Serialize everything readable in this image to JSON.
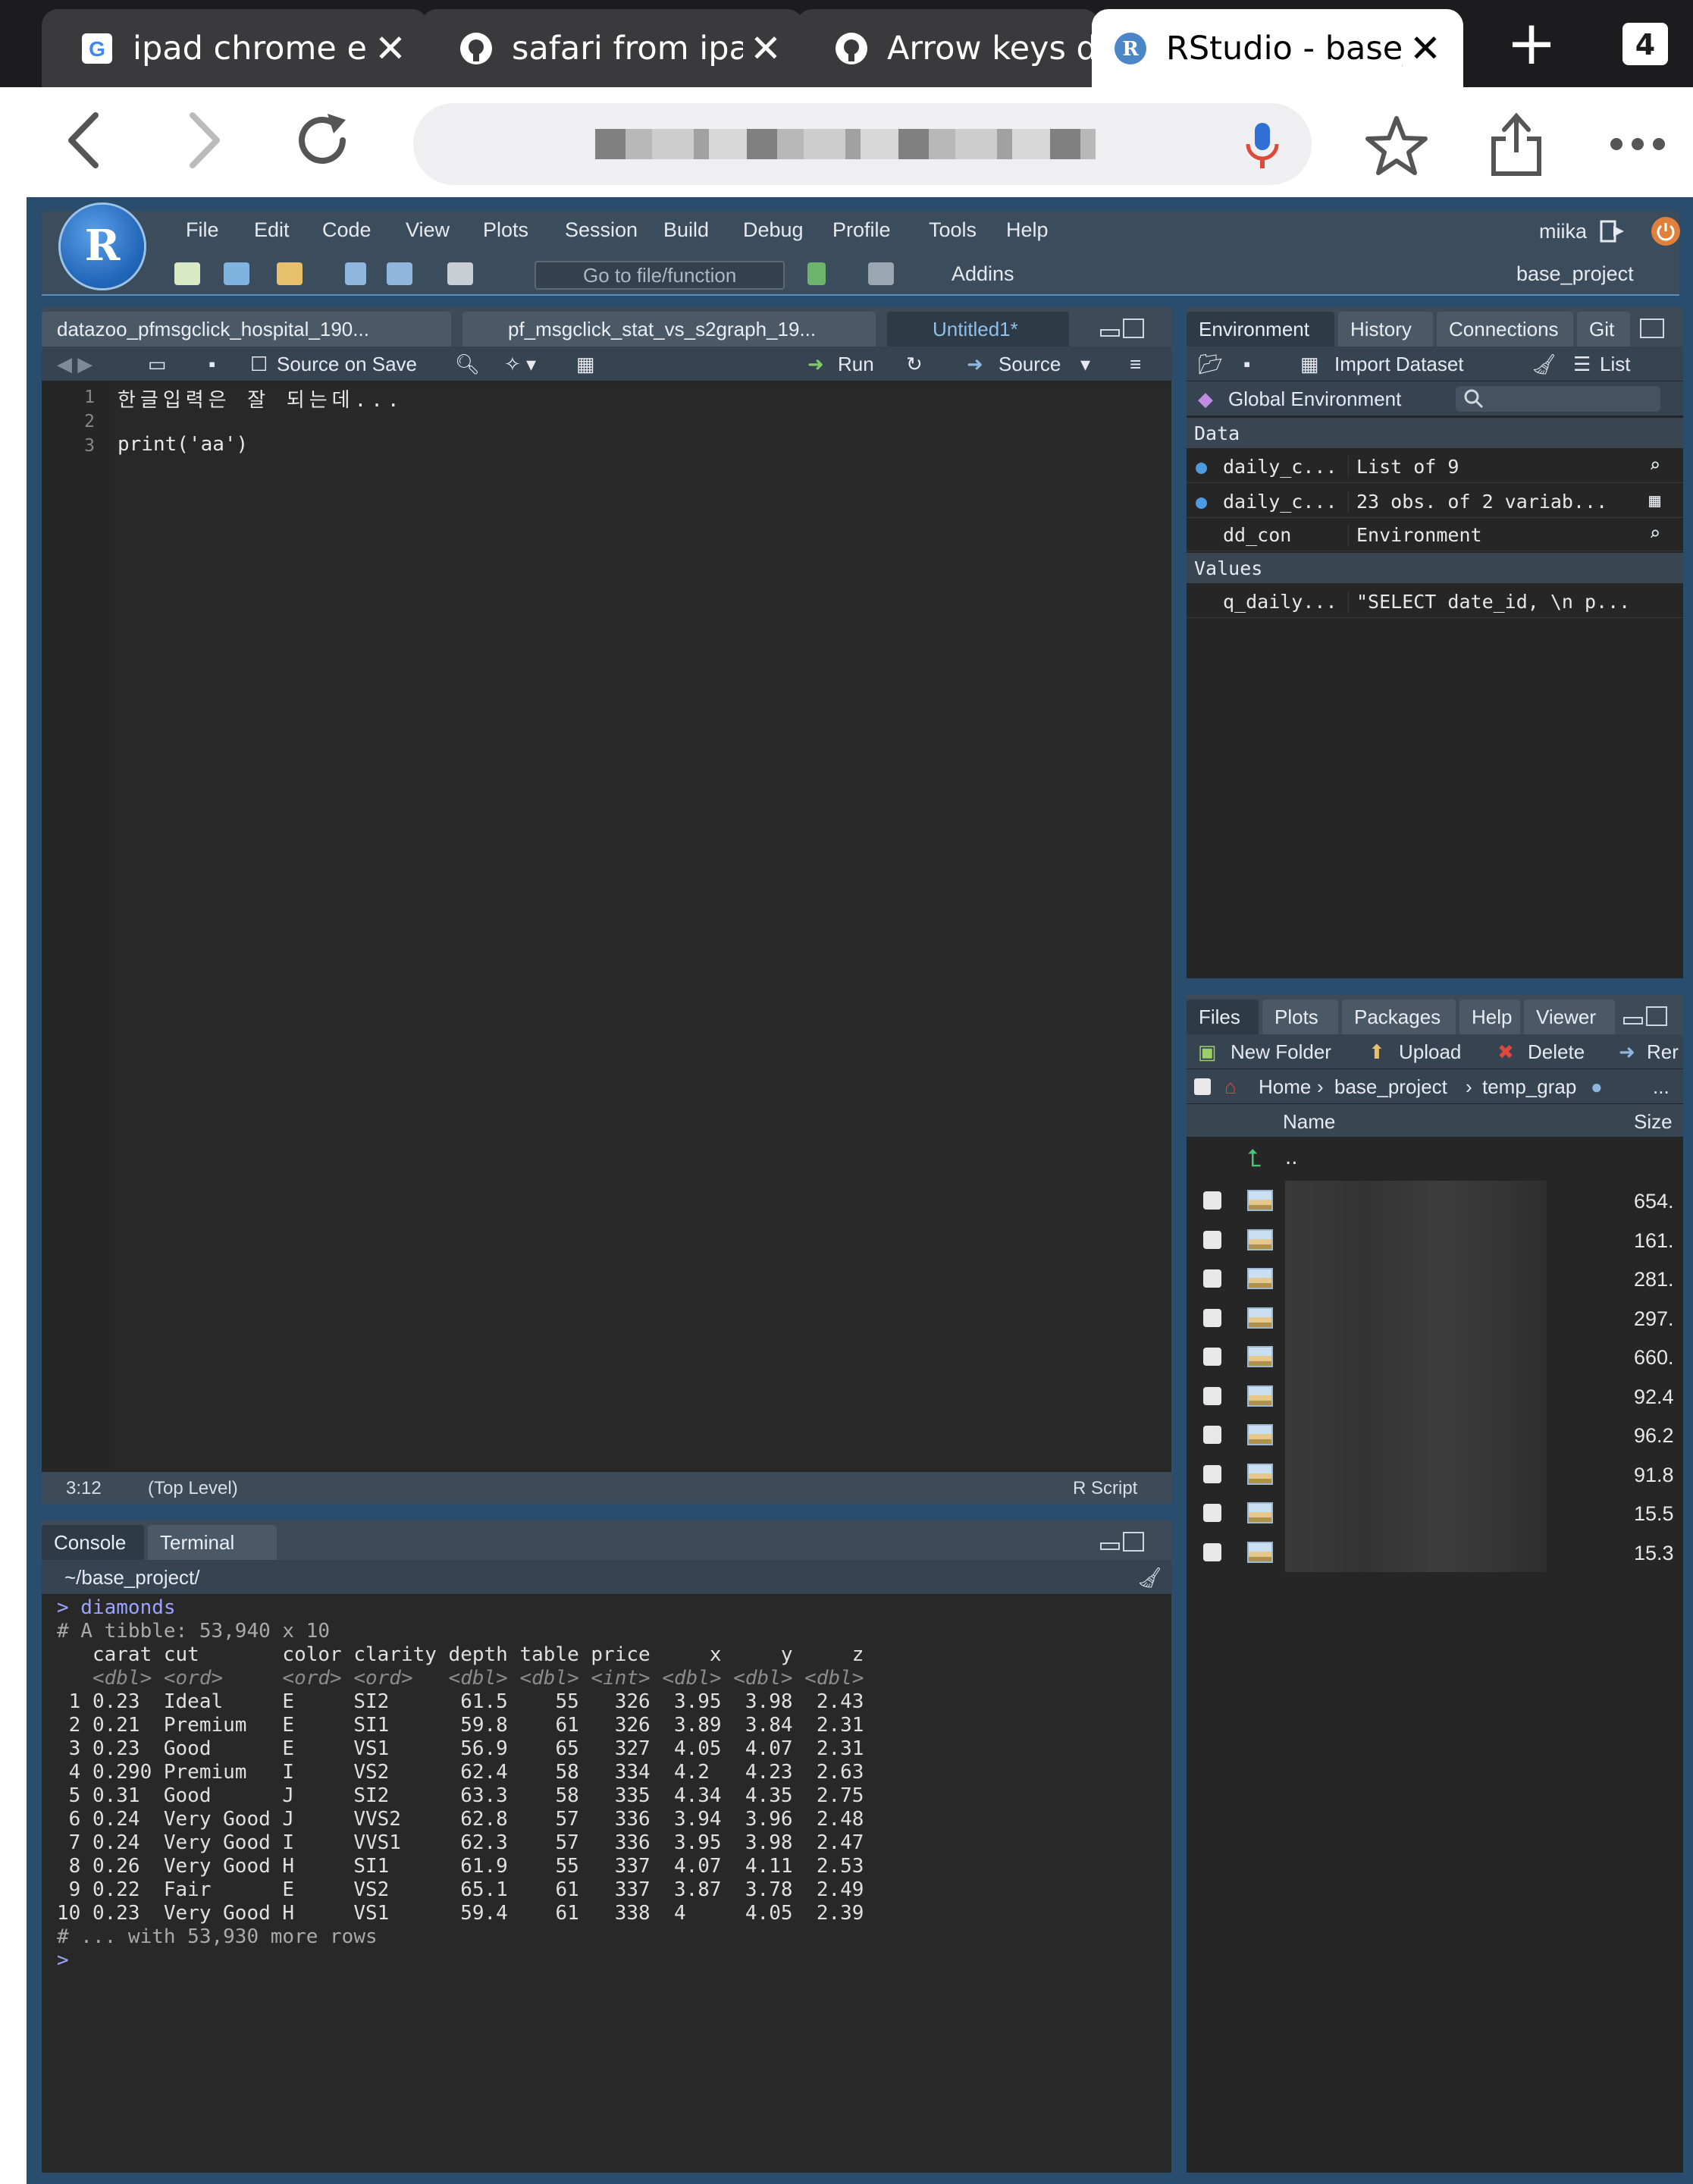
{
  "browser": {
    "tabs": [
      {
        "title": "ipad chrome exte",
        "icon": "google-icon"
      },
      {
        "title": "safari from ipad",
        "icon": "github-icon"
      },
      {
        "title": "Arrow keys dor",
        "icon": "github-icon"
      },
      {
        "title": "RStudio - base_pr",
        "icon": "rstudio-icon",
        "active": true
      }
    ],
    "new_tab": "+",
    "tab_count": "4"
  },
  "rstudio": {
    "logo": "R",
    "menu": [
      "File",
      "Edit",
      "Code",
      "View",
      "Plots",
      "Session",
      "Build",
      "Debug",
      "Profile",
      "Tools",
      "Help"
    ],
    "user": "miika",
    "goto_placeholder": "Go to file/function",
    "addins": "Addins",
    "project": "base_project",
    "source": {
      "tabs": [
        "datazoo_pfmsgclick_hospital_190...",
        "pf_msgclick_stat_vs_s2graph_19...",
        "Untitled1*"
      ],
      "source_on_save": "Source on Save",
      "run": "Run",
      "source_btn": "Source",
      "line_numbers": [
        "1",
        "2",
        "3"
      ],
      "lines": [
        "한글입력은 잘 되는데...",
        "",
        "print('aa')"
      ],
      "cursor_pos": "3:12",
      "scope": "(Top Level)",
      "file_type": "R Script"
    },
    "console": {
      "tabs": [
        "Console",
        "Terminal"
      ],
      "path": "~/base_project/",
      "lines": [
        "> diamonds",
        "# A tibble: 53,940 x 10",
        "   carat cut       color clarity depth table price     x     y     z",
        "   <dbl> <ord>     <ord> <ord>   <dbl> <dbl> <int> <dbl> <dbl> <dbl>",
        " 1 0.23  Ideal     E     SI2      61.5    55   326  3.95  3.98  2.43",
        " 2 0.21  Premium   E     SI1      59.8    61   326  3.89  3.84  2.31",
        " 3 0.23  Good      E     VS1      56.9    65   327  4.05  4.07  2.31",
        " 4 0.290 Premium   I     VS2      62.4    58   334  4.2   4.23  2.63",
        " 5 0.31  Good      J     SI2      63.3    58   335  4.34  4.35  2.75",
        " 6 0.24  Very Good J     VVS2     62.8    57   336  3.94  3.96  2.48",
        " 7 0.24  Very Good I     VVS1     62.3    57   336  3.95  3.98  2.47",
        " 8 0.26  Very Good H     SI1      61.9    55   337  4.07  4.11  2.53",
        " 9 0.22  Fair      E     VS2      65.1    61   337  3.87  3.78  2.49",
        "10 0.23  Very Good H     VS1      59.4    61   338  4     4.05  2.39",
        "# ... with 53,930 more rows",
        "> "
      ]
    },
    "environment": {
      "tabs": [
        "Environment",
        "History",
        "Connections",
        "Git"
      ],
      "import_dataset": "Import Dataset",
      "list_view": "List",
      "global_env": "Global Environment",
      "sections": {
        "data": "Data",
        "values": "Values"
      },
      "data_rows": [
        {
          "name": "daily_c...",
          "value": "List of 9"
        },
        {
          "name": "daily_c...",
          "value": "23 obs. of 2 variab..."
        },
        {
          "name": "dd_con",
          "value": "Environment"
        }
      ],
      "value_rows": [
        {
          "name": "q_daily...",
          "value": "\"SELECT date_id, \\n p..."
        }
      ]
    },
    "files": {
      "tabs": [
        "Files",
        "Plots",
        "Packages",
        "Help",
        "Viewer"
      ],
      "new_folder": "New Folder",
      "upload": "Upload",
      "delete": "Delete",
      "rename": "Rer",
      "breadcrumb": [
        "Home",
        "base_project",
        "temp_grap"
      ],
      "more": "...",
      "col_name": "Name",
      "col_size": "Size",
      "parent": "..",
      "sizes": [
        "654.",
        "161.",
        "281.",
        "297.",
        "660.",
        "92.4",
        "96.2",
        "91.8",
        "15.5",
        "15.3"
      ]
    }
  }
}
